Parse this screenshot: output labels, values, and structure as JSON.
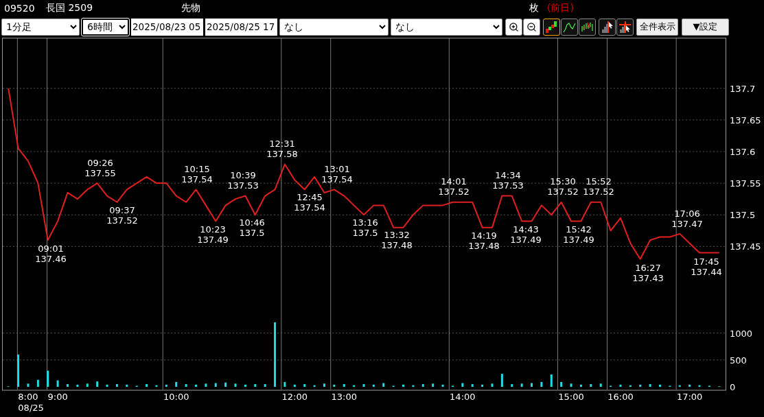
{
  "header": {
    "code": "09520",
    "name": "長国 2509",
    "market": "先物",
    "unit": "枚",
    "previous": "(前日)"
  },
  "toolbar": {
    "interval": "1分足",
    "span": "6時間",
    "start": "2025/08/23 05",
    "end": "2025/08/25 17",
    "indicator_1": "なし",
    "indicator_2": "なし",
    "chart_styles": [
      {
        "kind": "candle",
        "selected": true
      },
      {
        "kind": "line",
        "selected": false
      },
      {
        "kind": "bars",
        "selected": false
      }
    ],
    "cursor_tools": [
      {
        "kind": "pointer"
      },
      {
        "kind": "crosshair"
      }
    ],
    "show_all": "全件表示",
    "settings": "▼設定"
  },
  "price_chart": {
    "chart_data": {
      "type": "line",
      "grid": true,
      "ylim": [
        137.33,
        137.78
      ],
      "yticks": [
        {
          "value": 137.45,
          "label": "137.45"
        },
        {
          "value": 137.5,
          "label": "137.5"
        },
        {
          "value": 137.55,
          "label": "137.55"
        },
        {
          "value": 137.6,
          "label": "137.6"
        },
        {
          "value": 137.65,
          "label": "137.65"
        },
        {
          "value": 137.7,
          "label": "137.7"
        }
      ],
      "categories": [
        null,
        null,
        null,
        null,
        null,
        null,
        null,
        null,
        null,
        null,
        null,
        null,
        null,
        null,
        null,
        null,
        null,
        null,
        null,
        null,
        null,
        null,
        null,
        null,
        null,
        null,
        null,
        null,
        null,
        null,
        null,
        null,
        null,
        null,
        null,
        null,
        null,
        null,
        null,
        null,
        null,
        null,
        null,
        null,
        null,
        null,
        null,
        null,
        null,
        null,
        null,
        null,
        null,
        null,
        null,
        null,
        null,
        null,
        null,
        null,
        null,
        null,
        null,
        null,
        null,
        null,
        null,
        null,
        null,
        null,
        null,
        null,
        null
      ],
      "series": [
        {
          "color": "#e02020",
          "values": [
            137.7,
            137.605,
            137.585,
            137.55,
            137.46,
            137.49,
            137.535,
            137.525,
            137.54,
            137.55,
            137.53,
            137.52,
            137.54,
            137.55,
            137.56,
            137.55,
            137.55,
            137.53,
            137.52,
            137.54,
            137.515,
            137.49,
            137.515,
            137.525,
            137.53,
            137.5,
            137.53,
            137.54,
            137.58,
            137.555,
            137.54,
            137.56,
            137.535,
            137.54,
            137.53,
            137.515,
            137.5,
            137.515,
            137.515,
            137.48,
            137.48,
            137.5,
            137.515,
            137.515,
            137.515,
            137.52,
            137.52,
            137.52,
            137.48,
            137.48,
            137.53,
            137.53,
            137.49,
            137.49,
            137.515,
            137.5,
            137.52,
            137.49,
            137.49,
            137.52,
            137.52,
            137.475,
            137.495,
            137.455,
            137.43,
            137.46,
            137.465,
            137.465,
            137.47,
            137.455,
            137.44,
            137.44,
            137.44
          ]
        }
      ],
      "annotations": [
        "09:01\n137.46",
        "09:26\n137.55",
        "09:37\n137.52",
        "10:15\n137.54",
        "10:23\n137.49",
        "10:39\n137.53",
        "10:46\n137.5",
        "12:31\n137.58",
        "12:45\n137.54",
        "13:01\n137.54",
        "13:16\n137.5",
        "13:32\n137.48",
        "14:01\n137.52",
        "14:19\n137.48",
        "14:34\n137.53",
        "14:43\n137.49",
        "15:30\n137.52",
        "15:42\n137.49",
        "15:52\n137.52",
        "16:27\n137.43",
        "17:06\n137.47",
        "17:45\n137.44"
      ]
    }
  },
  "volume_chart": {
    "date": "08/25",
    "chart_data": {
      "type": "bar",
      "grid": true,
      "ylim": [
        0,
        1250
      ],
      "yticks": [
        {
          "value": 0,
          "label": "0"
        },
        {
          "value": 500,
          "label": "500"
        },
        {
          "value": 1000,
          "label": "1000"
        }
      ],
      "categories": [
        null,
        null,
        "8:00",
        null,
        null,
        "9:00",
        null,
        null,
        null,
        null,
        null,
        null,
        null,
        null,
        null,
        null,
        null,
        "10:00",
        null,
        null,
        null,
        null,
        null,
        null,
        null,
        null,
        null,
        null,
        null,
        "12:00",
        null,
        null,
        null,
        null,
        "13:00",
        null,
        null,
        null,
        null,
        null,
        null,
        null,
        null,
        null,
        null,
        null,
        "14:00",
        null,
        null,
        null,
        null,
        null,
        null,
        null,
        null,
        null,
        null,
        "15:00",
        null,
        null,
        null,
        null,
        "16:00",
        null,
        null,
        null,
        null,
        null,
        null,
        "17:00",
        null,
        null,
        null
      ],
      "series": [
        {
          "color": "#20dde5",
          "values": [
            10,
            600,
            60,
            130,
            300,
            120,
            50,
            40,
            60,
            100,
            40,
            50,
            40,
            20,
            50,
            30,
            40,
            90,
            50,
            40,
            60,
            70,
            80,
            60,
            40,
            50,
            50,
            1230,
            90,
            40,
            50,
            30,
            60,
            40,
            50,
            30,
            50,
            40,
            70,
            20,
            40,
            30,
            50,
            60,
            40,
            20,
            70,
            50,
            40,
            60,
            240,
            50,
            60,
            70,
            90,
            230,
            90,
            60,
            40,
            50,
            60,
            20,
            40,
            30,
            40,
            50,
            40,
            20,
            30,
            40,
            30,
            20,
            10
          ]
        }
      ]
    }
  }
}
